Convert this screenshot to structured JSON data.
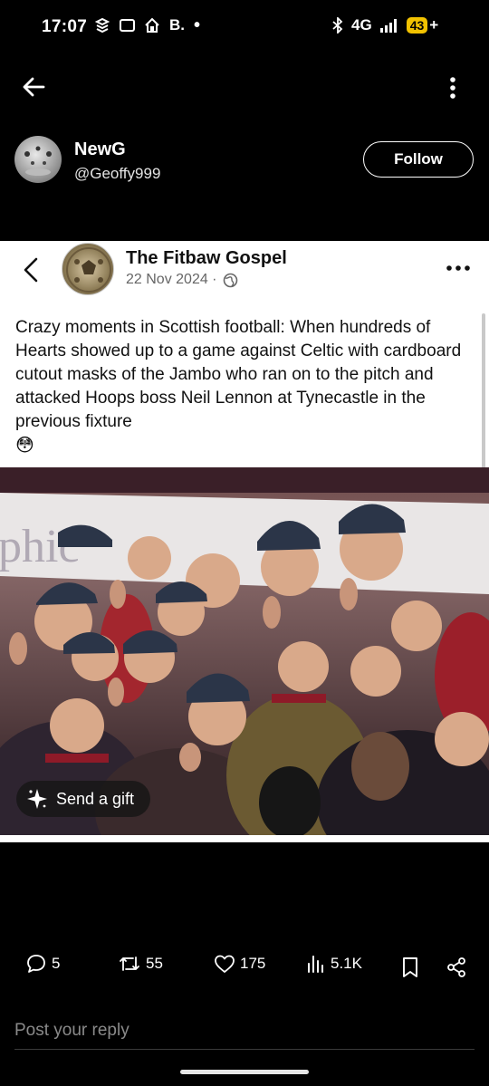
{
  "status_bar": {
    "time": "17:07",
    "carrier_text": "B.",
    "network": "4G",
    "battery": "43",
    "icons": [
      "notification-icon",
      "mail-icon",
      "home-app-icon",
      "bluetooth-icon",
      "signal-icon"
    ]
  },
  "profile": {
    "display_name": "NewG",
    "handle": "@Geoffy999",
    "follow_label": "Follow"
  },
  "embedded_post": {
    "page_name": "The Fitbaw Gospel",
    "date": "22 Nov 2024 ·",
    "text": "Crazy moments in Scottish football: When hundreds of Hearts showed up to a game against Celtic with cardboard cutout masks of the Jambo who ran on to the pitch and attacked Hoops boss Neil Lennon at Tynecastle in the previous fixture",
    "emoji": "😳",
    "banner_text": "phic",
    "gift_label": "Send a gift"
  },
  "actions": {
    "replies": "5",
    "reposts": "55",
    "likes": "175",
    "views": "5.1K"
  },
  "reply": {
    "placeholder": "Post your reply"
  },
  "colors": {
    "background": "#000000",
    "battery": "#f2c200",
    "embed_bg": "#ffffff"
  }
}
